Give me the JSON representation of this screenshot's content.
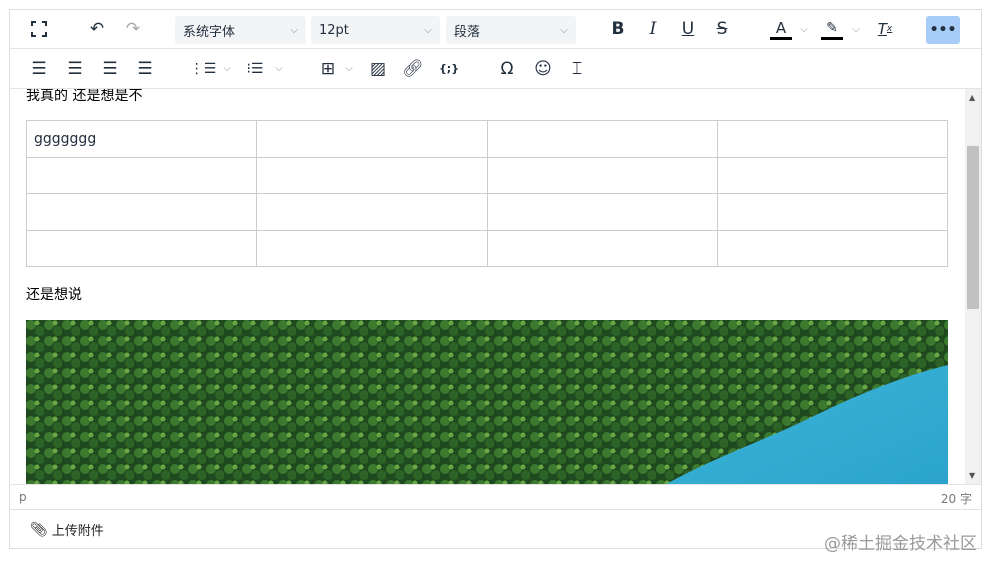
{
  "toolbar": {
    "font_family": "系统字体",
    "font_size": "12pt",
    "block_format": "段落",
    "icons": [
      "fullscreen-icon",
      "undo-icon",
      "redo-icon",
      "bold-icon",
      "italic-icon",
      "underline-icon",
      "strikethrough-icon",
      "text-color-icon",
      "highlight-icon",
      "clear-format-icon",
      "more-icon",
      "align-left-icon",
      "align-center-icon",
      "align-right-icon",
      "justify-icon",
      "numbered-list-icon",
      "bullet-list-icon",
      "table-icon",
      "image-icon",
      "link-icon",
      "code-sample-icon",
      "special-char-icon",
      "emoji-icon",
      "page-break-icon"
    ],
    "more_active_color": "#a6ccf7"
  },
  "content": {
    "top_line": "我真的 还是想是不",
    "table": [
      [
        "ggggggg",
        "",
        "",
        ""
      ],
      [
        "",
        "",
        "",
        ""
      ],
      [
        "",
        "",
        "",
        ""
      ],
      [
        "",
        "",
        "",
        ""
      ]
    ],
    "paragraph": "还是想说"
  },
  "status": {
    "path": "p",
    "word_count": "20 字"
  },
  "upload": {
    "label": "上传附件"
  },
  "watermark": "@稀土掘金技术社区"
}
